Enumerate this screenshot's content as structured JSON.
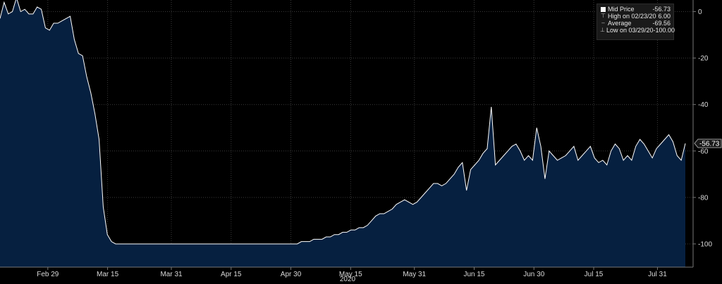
{
  "chart_data": {
    "type": "area",
    "x_label": "2020",
    "x_ticks": [
      "Feb 29",
      "Mar 15",
      "Mar 31",
      "Apr 15",
      "Apr 30",
      "May 15",
      "May 31",
      "Jun 15",
      "Jun 30",
      "Jul 15",
      "Jul 31"
    ],
    "y_ticks": [
      0,
      -20,
      -40,
      -60,
      -80,
      -100
    ],
    "ylim": [
      -110,
      5
    ],
    "last_value_label": "-56.73",
    "colors": {
      "fill": "#062040",
      "line": "#ffffff",
      "background": "#000000"
    },
    "series": [
      {
        "name": "Mid Price",
        "x_start": "2020-02-17",
        "x_end": "2020-08-07",
        "values": [
          -3,
          4,
          -1,
          0,
          6,
          0,
          1,
          -1,
          -1,
          2,
          1,
          -7,
          -8,
          -5,
          -5,
          -4,
          -3,
          -2,
          -12,
          -18,
          -19,
          -28,
          -35,
          -44,
          -55,
          -84,
          -96,
          -99,
          -100,
          -100,
          -100,
          -100,
          -100,
          -100,
          -100,
          -100,
          -100,
          -100,
          -100,
          -100,
          -100,
          -100,
          -100,
          -100,
          -100,
          -100,
          -100,
          -100,
          -100,
          -100,
          -100,
          -100,
          -100,
          -100,
          -100,
          -100,
          -100,
          -100,
          -100,
          -100,
          -100,
          -100,
          -100,
          -100,
          -100,
          -100,
          -100,
          -100,
          -100,
          -100,
          -100,
          -100,
          -100,
          -99,
          -99,
          -99,
          -98,
          -98,
          -98,
          -97,
          -97,
          -96,
          -96,
          -95,
          -95,
          -94,
          -94,
          -93,
          -93,
          -92,
          -90,
          -88,
          -87,
          -87,
          -86,
          -85,
          -83,
          -82,
          -81,
          -82,
          -83,
          -82,
          -80,
          -78,
          -76,
          -74,
          -74,
          -75,
          -74,
          -72,
          -70,
          -67,
          -65,
          -77,
          -68,
          -66,
          -64,
          -61,
          -59,
          -41,
          -66,
          -64,
          -62,
          -60,
          -58,
          -57,
          -60,
          -64,
          -62,
          -64,
          -50,
          -58,
          -72,
          -60,
          -62,
          -64,
          -63,
          -62,
          -60,
          -58,
          -64,
          -62,
          -60,
          -58,
          -63,
          -65,
          -64,
          -66,
          -60,
          -57,
          -59,
          -64,
          -62,
          -64,
          -58,
          -55,
          -57,
          -60,
          -63,
          -59,
          -57,
          -55,
          -53,
          -56,
          -62,
          -64,
          -56.73
        ]
      }
    ],
    "legend": {
      "items": [
        {
          "icon": "square",
          "label": "Mid Price",
          "value": "-56.73"
        },
        {
          "icon": "high",
          "label": "High on 02/23/20",
          "value": "6.00"
        },
        {
          "icon": "avg",
          "label": "Average",
          "value": "-69.56"
        },
        {
          "icon": "low",
          "label": "Low on 03/29/20",
          "value": "-100.00"
        }
      ]
    }
  }
}
